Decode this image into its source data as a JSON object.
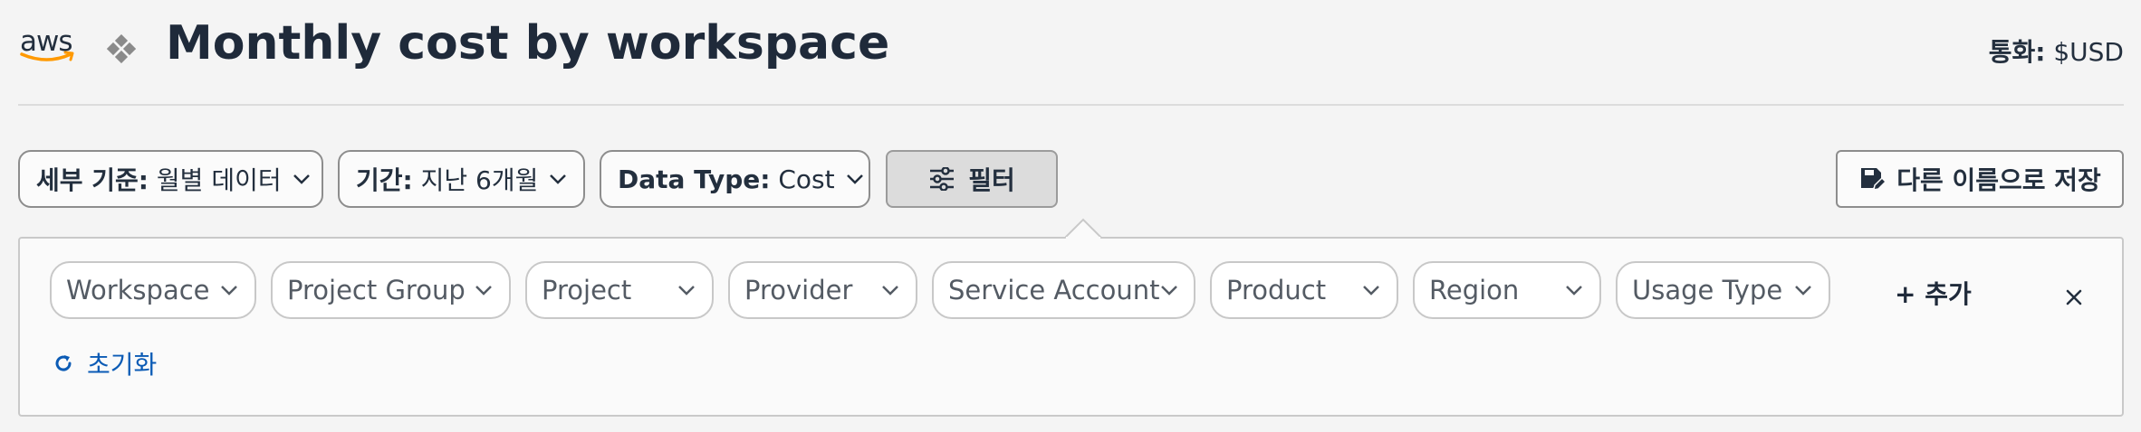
{
  "header": {
    "logo_text": "aws",
    "title": "Monthly cost by workspace",
    "currency_label": "통화:",
    "currency_value": "$USD",
    "logo_icon": "aws-smile-logo",
    "separator_icon": "diamond-icon"
  },
  "toolbar": {
    "granularity": {
      "label": "세부 기준:",
      "value": "월별 데이터"
    },
    "period": {
      "label": "기간:",
      "value": "지난 6개월"
    },
    "data_type": {
      "label": "Data Type:",
      "value": "Cost"
    },
    "filter_label": "필터",
    "filter_icon": "sliders-icon",
    "save_label": "다른 이름으로 저장",
    "save_icon": "save-edit-icon"
  },
  "filter_panel": {
    "chips": [
      {
        "label": "Workspace"
      },
      {
        "label": "Project Group"
      },
      {
        "label": "Project"
      },
      {
        "label": "Provider"
      },
      {
        "label": "Service Account"
      },
      {
        "label": "Product"
      },
      {
        "label": "Region"
      },
      {
        "label": "Usage Type"
      }
    ],
    "add_label": "+ 추가",
    "close_icon": "close-icon",
    "reset_label": "초기화",
    "reset_icon": "refresh-icon"
  },
  "colors": {
    "background": "#f4f4f4",
    "text_primary": "#232f3e",
    "link_blue": "#0b5bb5",
    "aws_orange": "#ff9900",
    "filter_active_bg": "#dcdcdc"
  }
}
